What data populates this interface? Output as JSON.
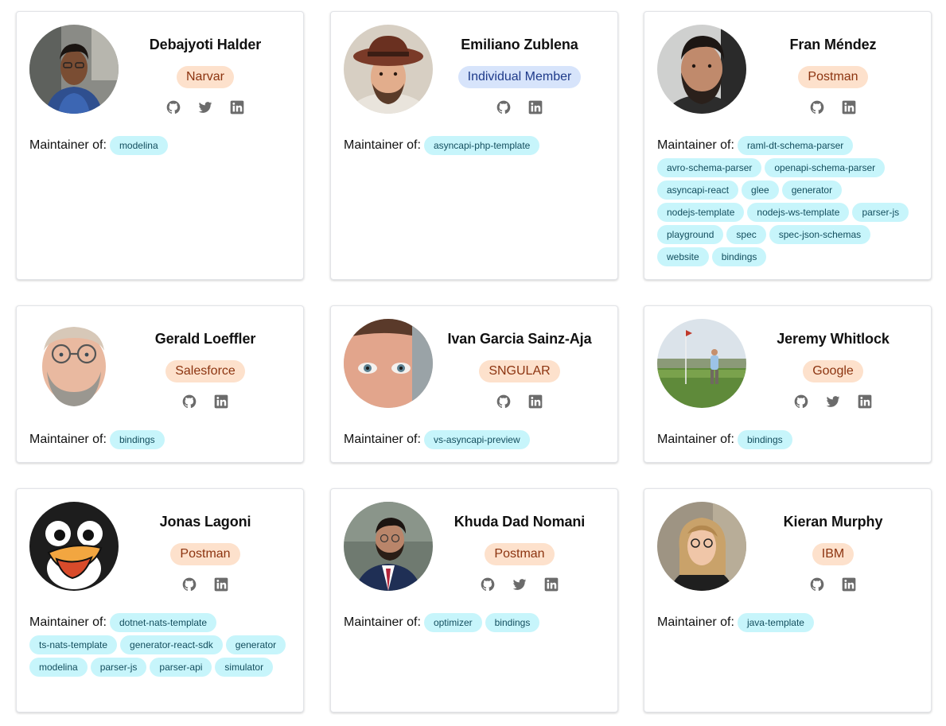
{
  "maintainer_label": "Maintainer of:",
  "cards": [
    {
      "name": "Debajyoti Halder",
      "company": "Narvar",
      "company_type": "org",
      "socials": [
        "github",
        "twitter",
        "linkedin"
      ],
      "repos": [
        "modelina"
      ]
    },
    {
      "name": "Emiliano Zublena",
      "company": "Individual Member",
      "company_type": "ind",
      "socials": [
        "github",
        "linkedin"
      ],
      "repos": [
        "asyncapi-php-template"
      ]
    },
    {
      "name": "Fran Méndez",
      "company": "Postman",
      "company_type": "org",
      "socials": [
        "github",
        "linkedin"
      ],
      "repos": [
        "raml-dt-schema-parser",
        "avro-schema-parser",
        "openapi-schema-parser",
        "asyncapi-react",
        "glee",
        "generator",
        "nodejs-template",
        "nodejs-ws-template",
        "parser-js",
        "playground",
        "spec",
        "spec-json-schemas",
        "website",
        "bindings"
      ]
    },
    {
      "name": "Gerald Loeffler",
      "company": "Salesforce",
      "company_type": "org",
      "socials": [
        "github",
        "linkedin"
      ],
      "repos": [
        "bindings"
      ]
    },
    {
      "name": "Ivan Garcia Sainz-Aja",
      "company": "SNGULAR",
      "company_type": "org",
      "socials": [
        "github",
        "linkedin"
      ],
      "repos": [
        "vs-asyncapi-preview"
      ]
    },
    {
      "name": "Jeremy Whitlock",
      "company": "Google",
      "company_type": "org",
      "socials": [
        "github",
        "twitter",
        "linkedin"
      ],
      "repos": [
        "bindings"
      ]
    },
    {
      "name": "Jonas Lagoni",
      "company": "Postman",
      "company_type": "org",
      "socials": [
        "github",
        "linkedin"
      ],
      "repos": [
        "dotnet-nats-template",
        "ts-nats-template",
        "generator-react-sdk",
        "generator",
        "modelina",
        "parser-js",
        "parser-api",
        "simulator"
      ]
    },
    {
      "name": "Khuda Dad Nomani",
      "company": "Postman",
      "company_type": "org",
      "socials": [
        "github",
        "twitter",
        "linkedin"
      ],
      "repos": [
        "optimizer",
        "bindings"
      ]
    },
    {
      "name": "Kieran Murphy",
      "company": "IBM",
      "company_type": "org",
      "socials": [
        "github",
        "linkedin"
      ],
      "repos": [
        "java-template"
      ]
    }
  ],
  "colors": {
    "company_bg": "#fde1cc",
    "company_text": "#8c3410",
    "individual_bg": "#d7e4fb",
    "individual_text": "#1e3a8a",
    "tag_bg": "#c7f5fb",
    "tag_text": "#134e5e",
    "icon": "#6b6b6b"
  }
}
